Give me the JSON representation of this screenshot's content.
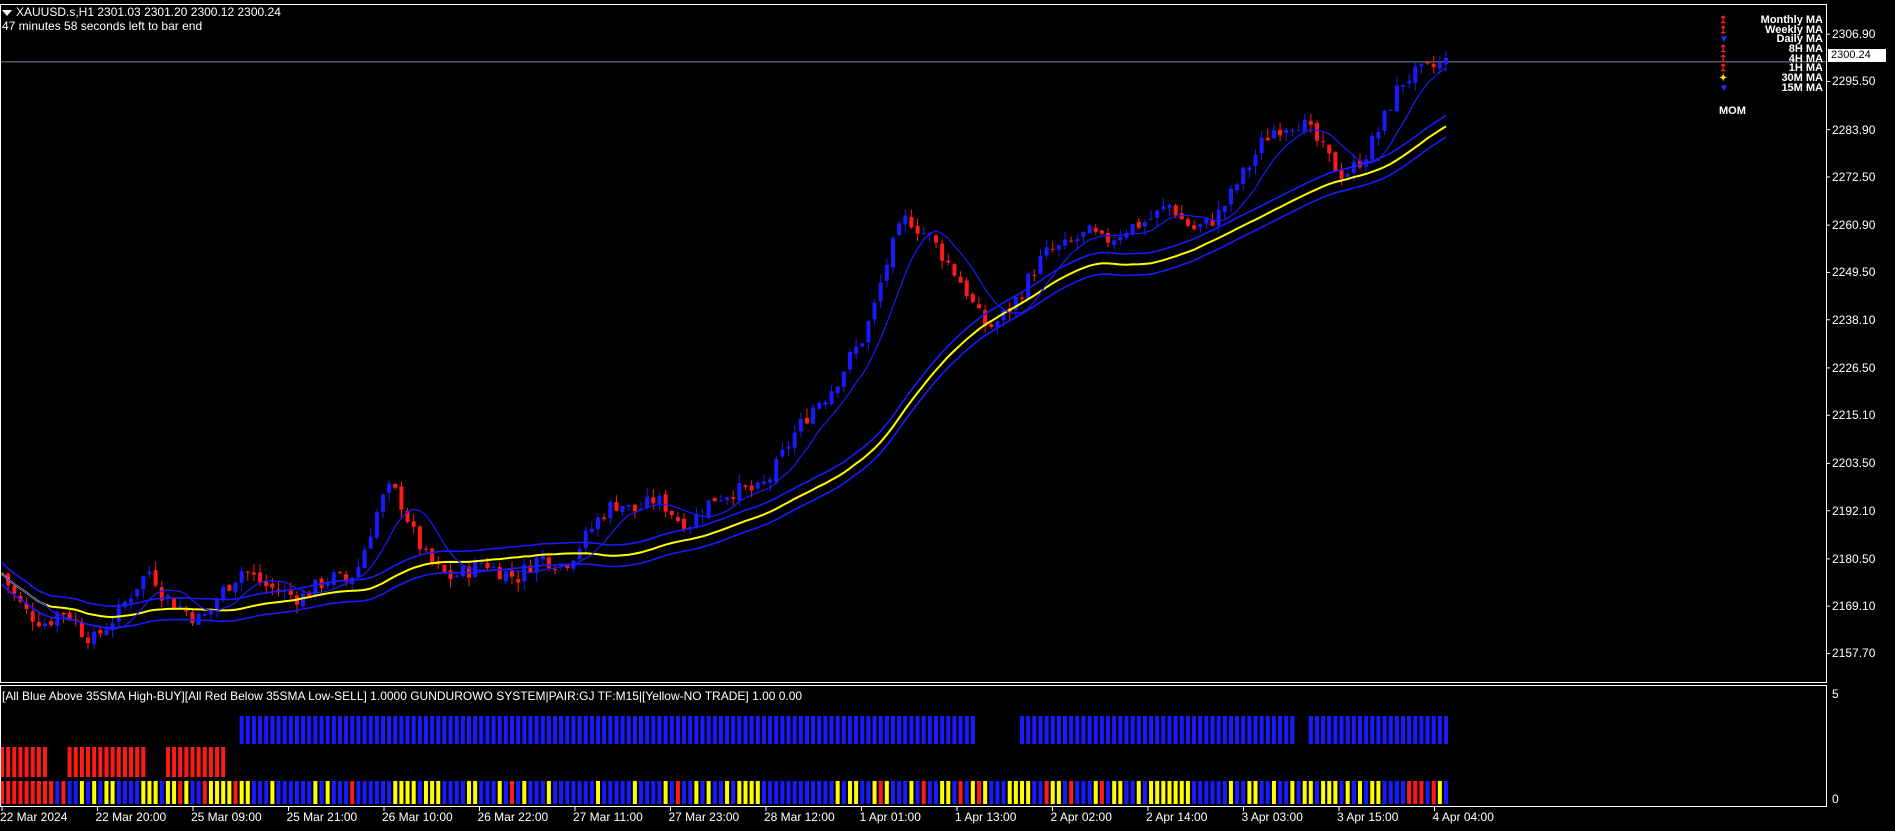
{
  "header": {
    "symbol_line": "XAUUSD.s,H1  2301.03 2301.20 2300.12 2300.24",
    "timer": "47 minutes 58 seconds left to bar end"
  },
  "current_price": "2300.24",
  "price_axis": [
    "2306.90",
    "2295.50",
    "2283.90",
    "2272.50",
    "2260.90",
    "2249.50",
    "2238.10",
    "2226.50",
    "2215.10",
    "2203.50",
    "2192.10",
    "2180.50",
    "2169.10",
    "2157.70"
  ],
  "time_axis": [
    "22 Mar 2024",
    "22 Mar 20:00",
    "25 Mar 09:00",
    "25 Mar 21:00",
    "26 Mar 10:00",
    "26 Mar 22:00",
    "27 Mar 11:00",
    "27 Mar 23:00",
    "28 Mar 12:00",
    "1 Apr 01:00",
    "1 Apr 13:00",
    "2 Apr 02:00",
    "2 Apr 14:00",
    "3 Apr 03:00",
    "3 Apr 15:00",
    "4 Apr 04:00"
  ],
  "ma_legend": [
    {
      "label": "Monthly MA",
      "color": "#ff2020"
    },
    {
      "label": "Weekly MA",
      "color": "#ff2020"
    },
    {
      "label": "Daily MA",
      "color": "#2030ff"
    },
    {
      "label": "8H MA",
      "color": "#ff2020"
    },
    {
      "label": "4H MA",
      "color": "#ff2020"
    },
    {
      "label": "1H MA",
      "color": "#ff2020"
    },
    {
      "label": "30M MA",
      "color": "#ffe000"
    },
    {
      "label": "15M MA",
      "color": "#2030ff"
    }
  ],
  "mom_label": "MOM",
  "subwindow": {
    "title": "[All Blue Above 35SMA High-BUY][All Red Below 35SMA Low-SELL] 1.0000  GUNDUROWO SYSTEM|PAIR:GJ TF:M15|[Yellow-NO TRADE] 1.00 0.00",
    "scale_top": "5",
    "scale_bottom": "0"
  },
  "colors": {
    "bull": "#1a1aff",
    "bear": "#ff1a1a",
    "ma_yellow": "#ffff00",
    "ma_blue": "#1a1aff",
    "ma_red": "#ff1a1a",
    "grid": "#ffffff"
  },
  "chart_data": {
    "type": "candlestick",
    "title": "XAUUSD.s,H1",
    "ylim": [
      2153,
      2312
    ],
    "x_start": "22 Mar 2024",
    "x_end": "4 Apr 04:00",
    "close_path": [
      2177,
      2172,
      2168,
      2166,
      2165,
      2168,
      2167,
      2163,
      2161,
      2164,
      2167,
      2171,
      2175,
      2178,
      2172,
      2170,
      2168,
      2166,
      2167,
      2172,
      2175,
      2178,
      2176,
      2174,
      2173,
      2172,
      2171,
      2173,
      2175,
      2176,
      2175,
      2178,
      2186,
      2194,
      2198,
      2193,
      2186,
      2181,
      2178,
      2176,
      2177,
      2178,
      2180,
      2178,
      2177,
      2176,
      2179,
      2181,
      2180,
      2179,
      2182,
      2186,
      2190,
      2193,
      2194,
      2192,
      2193,
      2195,
      2193,
      2190,
      2189,
      2192,
      2195,
      2196,
      2197,
      2197,
      2197,
      2200,
      2205,
      2210,
      2214,
      2218,
      2220,
      2224,
      2229,
      2233,
      2240,
      2250,
      2258,
      2263,
      2260,
      2258,
      2254,
      2250,
      2246,
      2240,
      2236,
      2238,
      2241,
      2245,
      2250,
      2254,
      2255,
      2256,
      2258,
      2259,
      2257,
      2258,
      2260,
      2261,
      2262,
      2264,
      2266,
      2262,
      2260,
      2261,
      2263,
      2267,
      2272,
      2276,
      2281,
      2284,
      2285,
      2286,
      2284,
      2280,
      2276,
      2273,
      2275,
      2278,
      2283,
      2289,
      2295,
      2297,
      2298,
      2299,
      2300.24
    ]
  }
}
